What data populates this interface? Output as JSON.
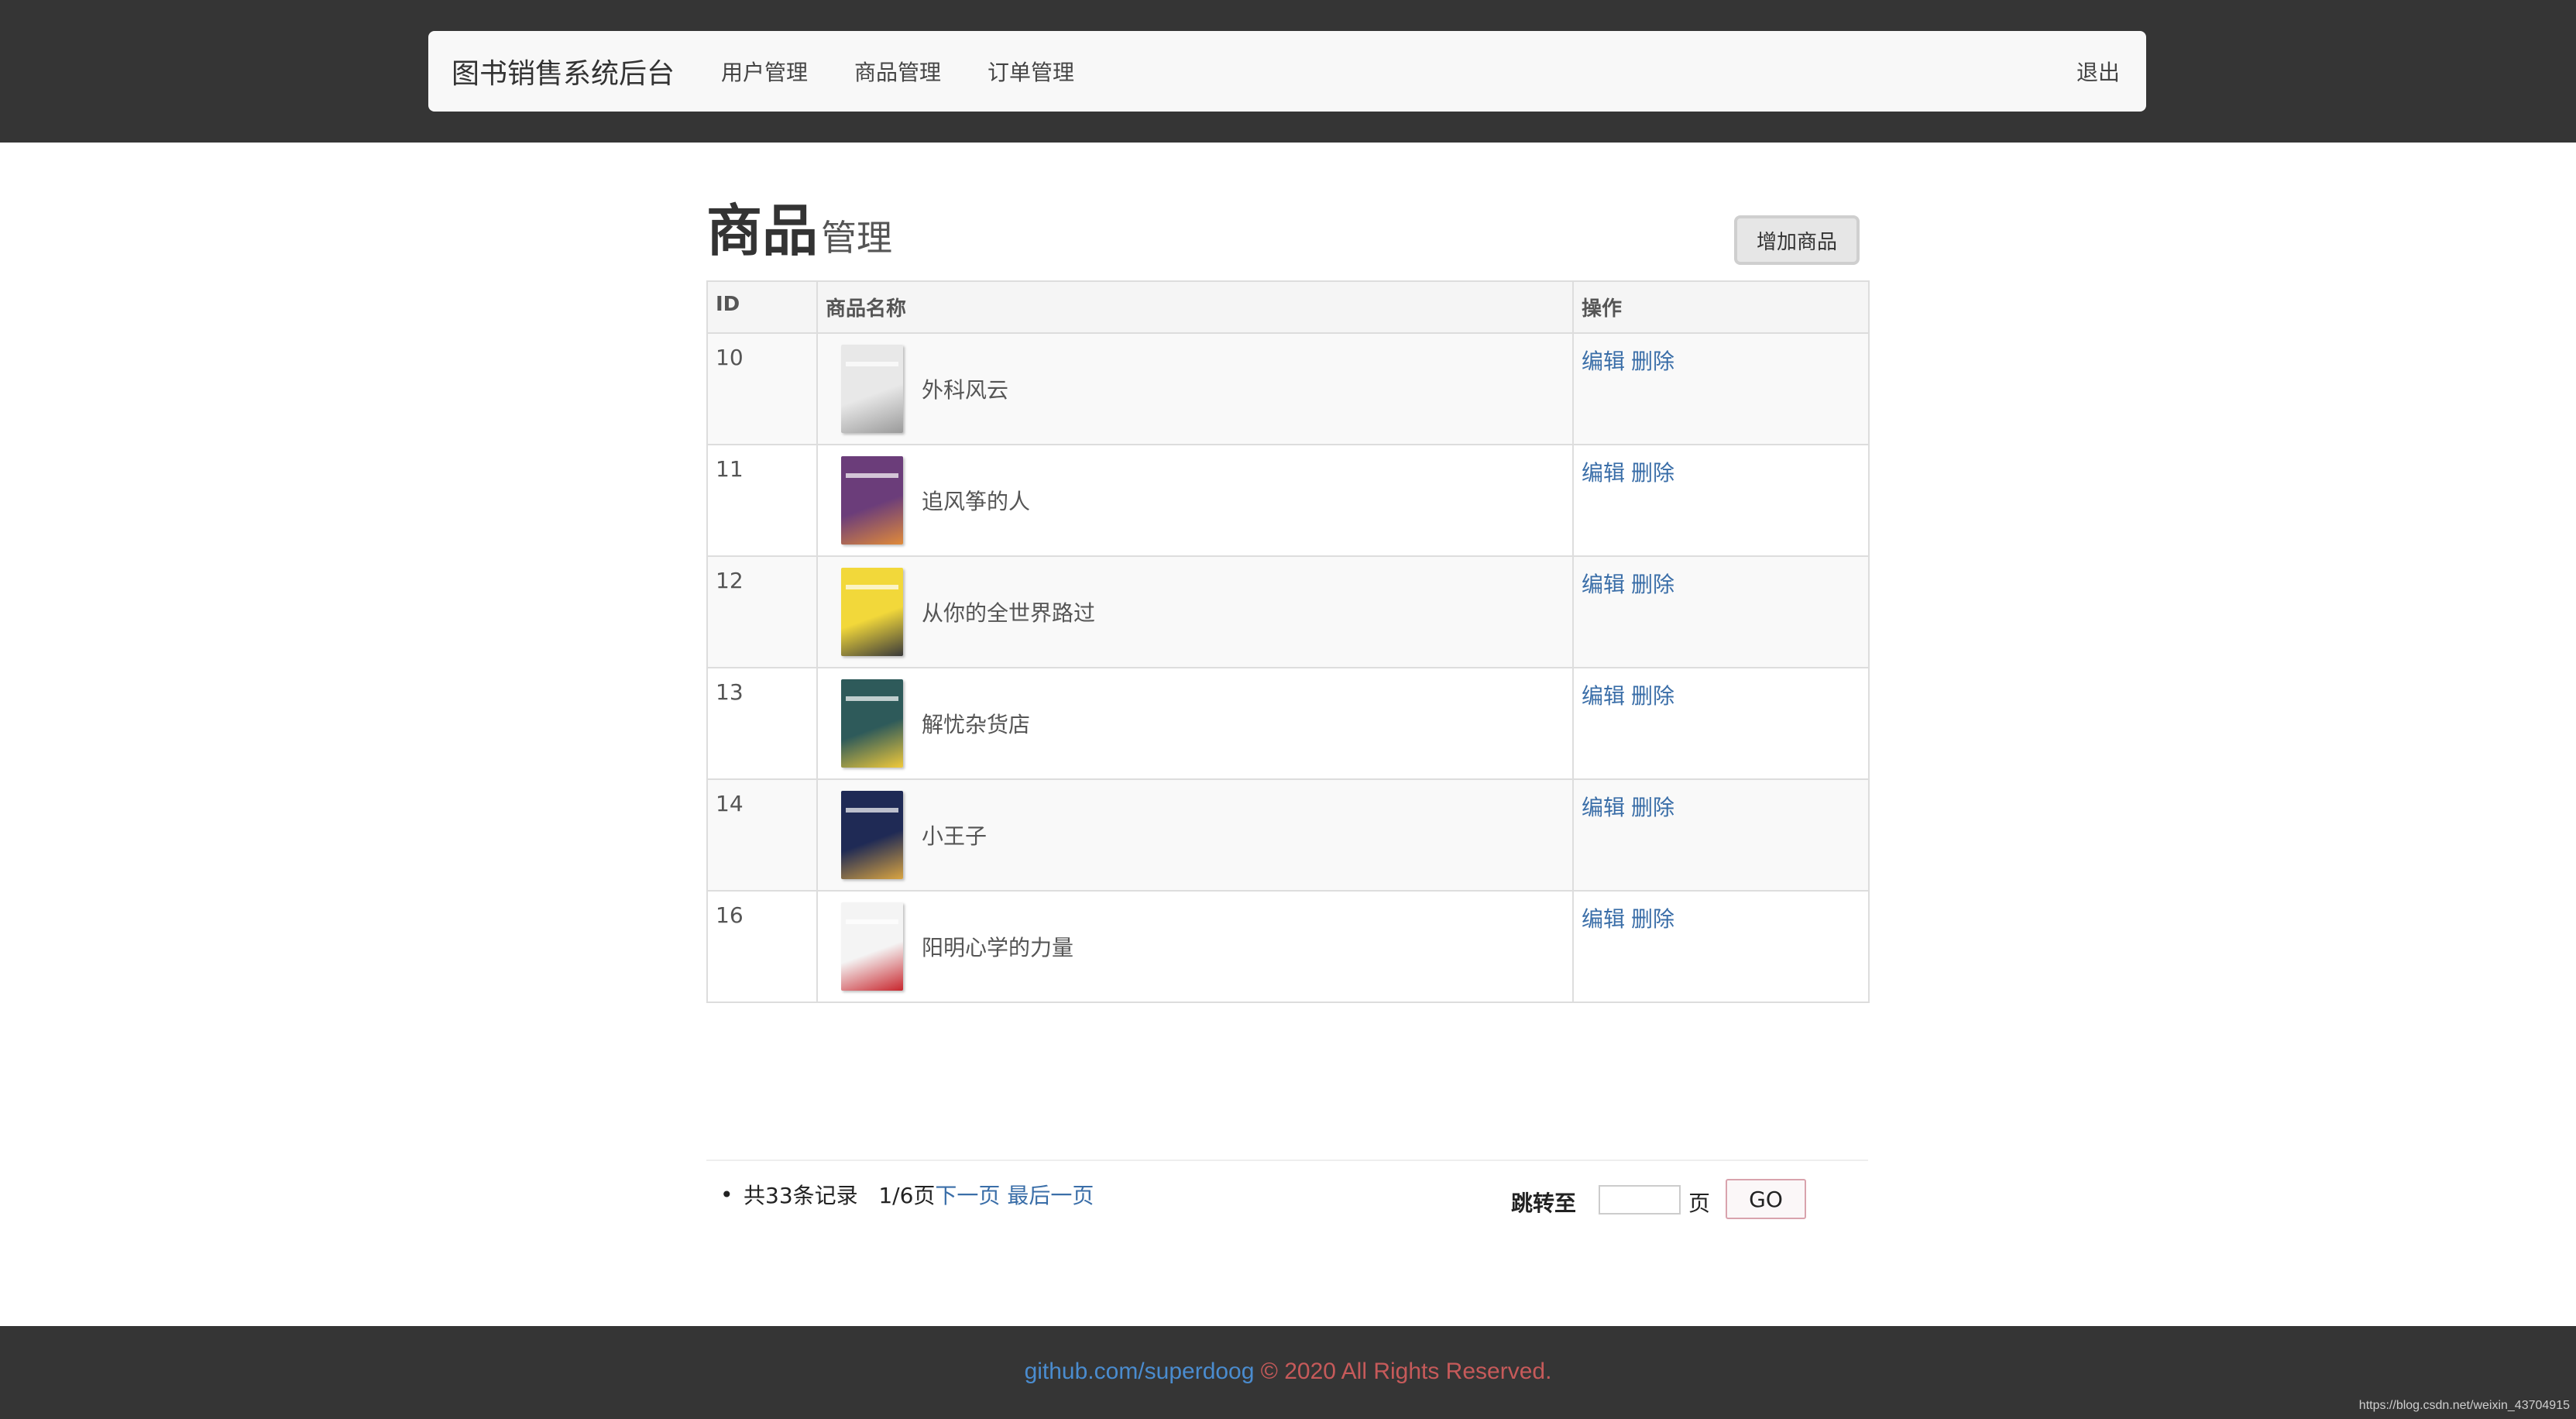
{
  "header": {
    "brand": "图书销售系统后台",
    "nav": [
      "用户管理",
      "商品管理",
      "订单管理"
    ],
    "logout": "退出"
  },
  "page": {
    "title_big": "商品",
    "title_small": "管理",
    "add_button": "增加商品"
  },
  "table": {
    "columns": [
      "ID",
      "商品名称",
      "操作"
    ],
    "actions": {
      "edit": "编辑",
      "delete": "删除"
    },
    "rows": [
      {
        "id": "10",
        "name": "外科风云",
        "cover_colors": [
          "#e8e8e8",
          "#9a9a9a"
        ]
      },
      {
        "id": "11",
        "name": "追风筝的人",
        "cover_colors": [
          "#6b3d7a",
          "#e08a3a"
        ]
      },
      {
        "id": "12",
        "name": "从你的全世界路过",
        "cover_colors": [
          "#f2d83a",
          "#3a3a3a"
        ]
      },
      {
        "id": "13",
        "name": "解忧杂货店",
        "cover_colors": [
          "#2e5a5a",
          "#f0c93a"
        ]
      },
      {
        "id": "14",
        "name": "小王子",
        "cover_colors": [
          "#1f2a55",
          "#d9a441"
        ]
      },
      {
        "id": "16",
        "name": "阳明心学的力量",
        "cover_colors": [
          "#f4f4f4",
          "#c8262d"
        ]
      }
    ]
  },
  "pagination": {
    "total_text": "共33条记录",
    "page_text": "1/6页",
    "next": "下一页",
    "last": "最后一页",
    "jump_label": "跳转至",
    "jump_value": "",
    "jump_unit": "页",
    "go": "GO"
  },
  "footer": {
    "link": "github.com/superdoog",
    "rights": "© 2020 All Rights Reserved.",
    "watermark": "https://blog.csdn.net/weixin_43704915"
  }
}
